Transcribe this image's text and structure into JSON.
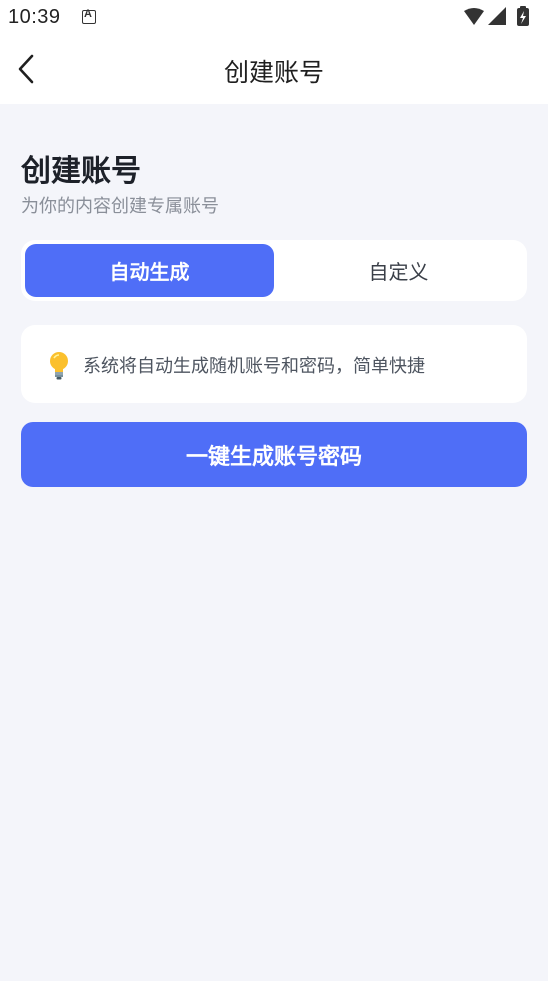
{
  "status_bar": {
    "time": "10:39",
    "notification_icon": "text-a-icon",
    "icons": [
      "wifi-icon",
      "cellular-signal-icon",
      "battery-charging-icon"
    ]
  },
  "header": {
    "back_icon": "chevron-left-icon",
    "title": "创建账号"
  },
  "intro": {
    "heading": "创建账号",
    "subtitle": "为你的内容创建专属账号"
  },
  "mode_tabs": {
    "selected": "auto",
    "items": [
      {
        "id": "auto",
        "label": "自动生成"
      },
      {
        "id": "custom",
        "label": "自定义"
      }
    ]
  },
  "info": {
    "icon": "lightbulb-icon",
    "text": "系统将自动生成随机账号和密码，简单快捷"
  },
  "primary_action": {
    "label": "一键生成账号密码"
  },
  "colors": {
    "accent": "#4f6ef7",
    "background": "#f4f5fa",
    "card": "#ffffff"
  }
}
